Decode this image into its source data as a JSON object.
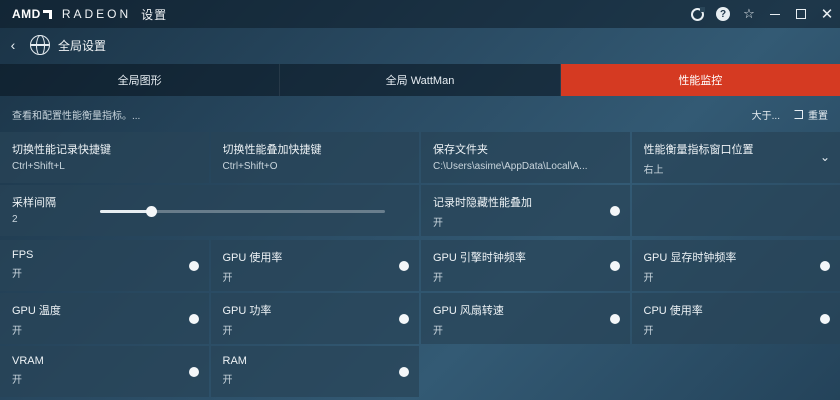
{
  "titlebar": {
    "brand": "AMD",
    "product": "RADEON",
    "app_word": "设置",
    "icons": [
      "sync-icon",
      "help-icon",
      "star-icon",
      "minimize-icon",
      "maximize-icon",
      "close-icon"
    ],
    "help_glyph": "?",
    "star_glyph": "☆",
    "close_glyph": "✕"
  },
  "nav": {
    "back_glyph": "‹",
    "title": "全局设置"
  },
  "tabs": [
    {
      "label": "全局图形",
      "active": false
    },
    {
      "label": "全局 WattMan",
      "active": false
    },
    {
      "label": "性能监控",
      "active": true
    }
  ],
  "subheader": {
    "description": "查看和配置性能衡量指标。...",
    "about": "大于...",
    "reset": "重置"
  },
  "settings": {
    "log_hotkey": {
      "label": "切换性能记录快捷键",
      "value": "Ctrl+Shift+L"
    },
    "overlay_hotkey": {
      "label": "切换性能叠加快捷键",
      "value": "Ctrl+Shift+O"
    },
    "save_folder": {
      "label": "保存文件夹",
      "value": "C:\\Users\\asime\\AppData\\Local\\A..."
    },
    "overlay_position": {
      "label": "性能衡量指标窗口位置",
      "value": "右上"
    },
    "sample_interval": {
      "label": "采样间隔",
      "value": "2",
      "slider_fraction": 0.18
    },
    "hide_overlay_when_logging": {
      "label": "记录时隐藏性能叠加",
      "value": "开"
    }
  },
  "metrics": [
    {
      "label": "FPS",
      "value": "开"
    },
    {
      "label": "GPU 使用率",
      "value": "开"
    },
    {
      "label": "GPU 引擎时钟频率",
      "value": "开"
    },
    {
      "label": "GPU 显存时钟频率",
      "value": "开"
    },
    {
      "label": "GPU 温度",
      "value": "开"
    },
    {
      "label": "GPU 功率",
      "value": "开"
    },
    {
      "label": "GPU 风扇转速",
      "value": "开"
    },
    {
      "label": "CPU 使用率",
      "value": "开"
    },
    {
      "label": "VRAM",
      "value": "开"
    },
    {
      "label": "RAM",
      "value": "开"
    }
  ],
  "colors": {
    "accent": "#d53a22",
    "background": "#2a4b63",
    "tile": "#284458"
  }
}
